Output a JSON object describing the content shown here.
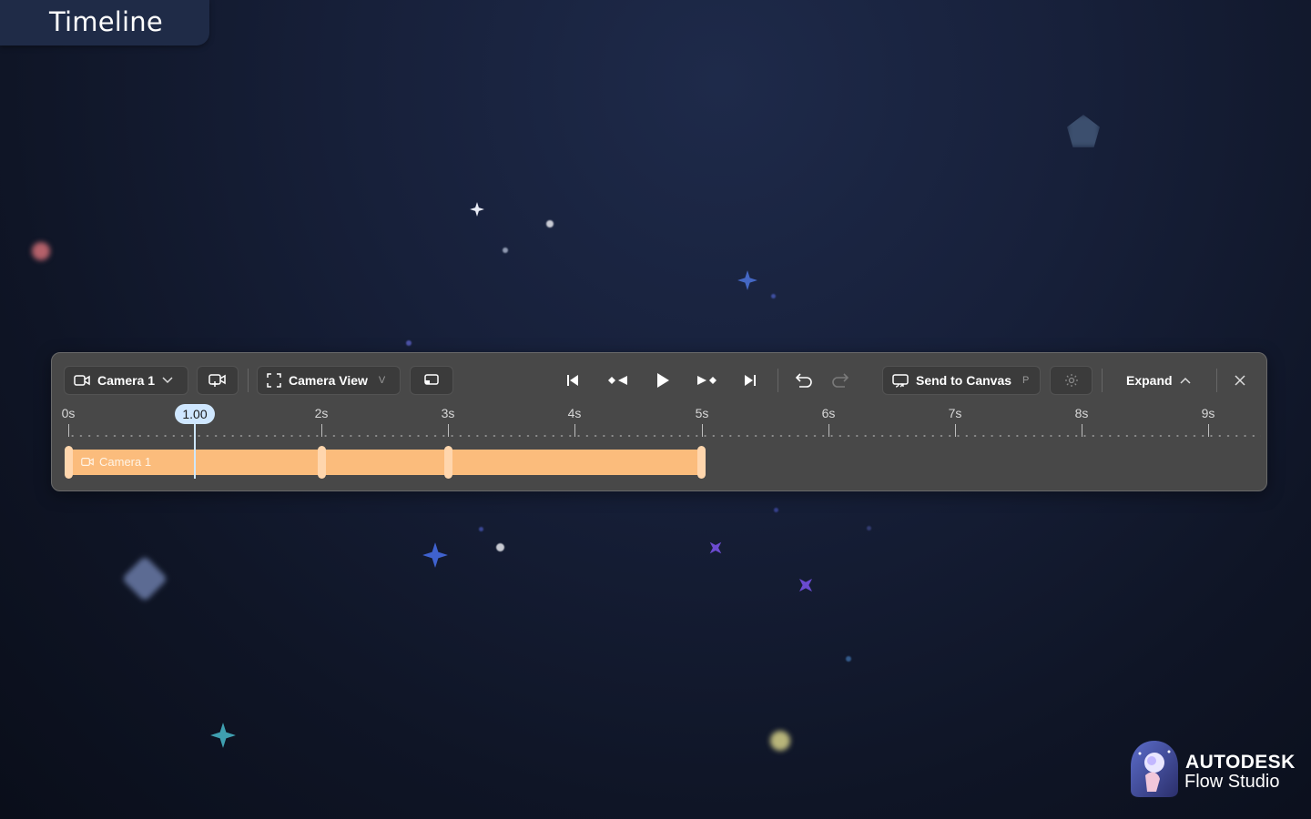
{
  "page": {
    "title": "Timeline"
  },
  "toolbar": {
    "camera_select": "Camera 1",
    "view_select": "Camera View",
    "view_shortcut": "V",
    "send_to_canvas": "Send to Canvas",
    "send_shortcut": "P",
    "expand": "Expand"
  },
  "timeline": {
    "ticks": [
      "0s",
      "2s",
      "3s",
      "4s",
      "5s",
      "6s",
      "7s",
      "8s",
      "9s"
    ],
    "playhead": "1.00",
    "clip_label": "Camera 1"
  },
  "brand": {
    "name": "AUTODESK",
    "product": "Flow Studio"
  },
  "colors": {
    "background": "#131a2e",
    "panel": "#484848",
    "clip": "#fbbc7c",
    "playhead": "#cfe7ff"
  },
  "icons": {
    "camera": "video-camera-icon",
    "add_camera": "add-camera-icon",
    "frame": "frame-icon",
    "cast": "cast-icon",
    "jump_start": "skip-start-icon",
    "prev_key": "prev-keyframe-icon",
    "play": "play-icon",
    "next_key": "next-keyframe-icon",
    "jump_end": "skip-end-icon",
    "undo": "undo-icon",
    "redo": "redo-icon",
    "settings": "gear-icon",
    "chevron": "chevron-up-icon",
    "close": "close-icon"
  }
}
